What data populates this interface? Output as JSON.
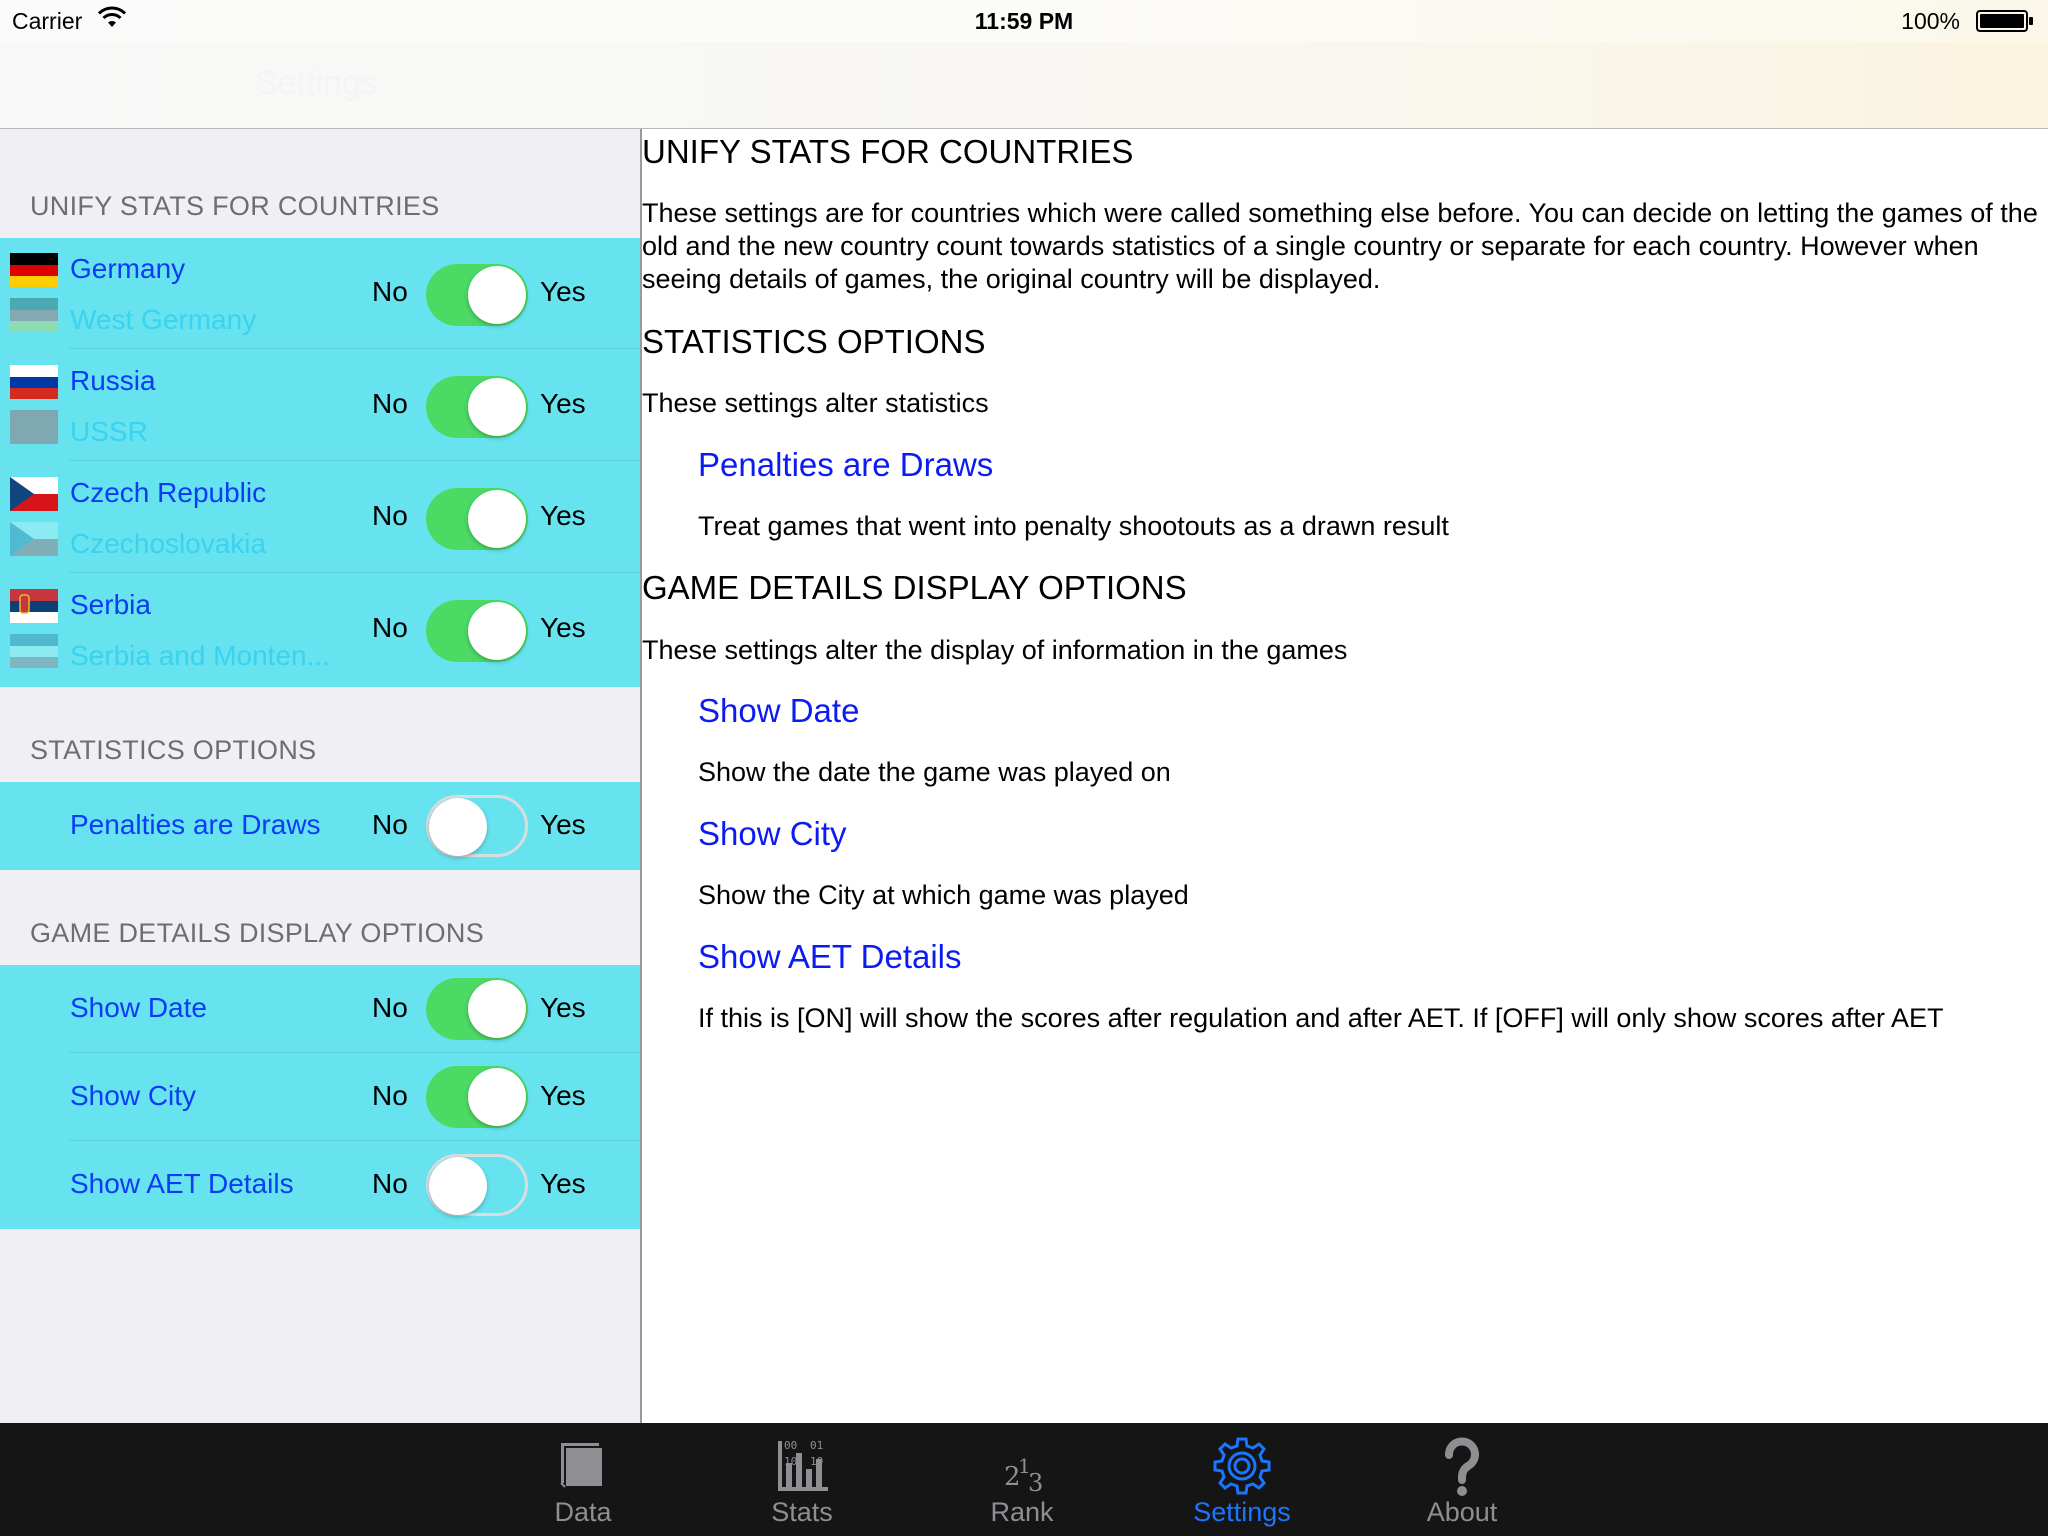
{
  "status_bar": {
    "carrier": "Carrier",
    "time": "11:59 PM",
    "battery": "100%"
  },
  "nav_bar": {
    "title": "Settings"
  },
  "left": {
    "unify": {
      "header": "UNIFY STATS FOR COUNTRIES",
      "rows": [
        {
          "country": "Germany",
          "old_country": "West Germany",
          "no": "No",
          "yes": "Yes",
          "on": true
        },
        {
          "country": "Russia",
          "old_country": "USSR",
          "no": "No",
          "yes": "Yes",
          "on": true
        },
        {
          "country": "Czech Republic",
          "old_country": "Czechoslovakia",
          "no": "No",
          "yes": "Yes",
          "on": true
        },
        {
          "country": "Serbia",
          "old_country": "Serbia and Monten...",
          "no": "No",
          "yes": "Yes",
          "on": true
        }
      ]
    },
    "statistics": {
      "header": "STATISTICS OPTIONS",
      "rows": [
        {
          "label": "Penalties are Draws",
          "no": "No",
          "yes": "Yes",
          "on": false
        }
      ]
    },
    "game_details": {
      "header": "GAME DETAILS DISPLAY OPTIONS",
      "rows": [
        {
          "label": "Show Date",
          "no": "No",
          "yes": "Yes",
          "on": true
        },
        {
          "label": "Show City",
          "no": "No",
          "yes": "Yes",
          "on": true
        },
        {
          "label": "Show AET Details",
          "no": "No",
          "yes": "Yes",
          "on": false
        }
      ]
    }
  },
  "right": {
    "unify_heading": "UNIFY STATS FOR COUNTRIES",
    "unify_text": "These settings are for countries which were called something else before. You can decide on letting the games of the old and the new country count towards statistics of a single country or separate for each country. However when seeing details of games, the original country will be displayed.",
    "statistics_heading": "STATISTICS OPTIONS",
    "statistics_text": "These settings alter statistics",
    "penalties_link": "Penalties are Draws",
    "penalties_desc": "Treat games that went into penalty shootouts as a drawn result",
    "game_heading": "GAME DETAILS DISPLAY OPTIONS",
    "game_text": "These settings alter the display of information in the games",
    "show_date_link": "Show Date",
    "show_date_desc": "Show the date the game was played on",
    "show_city_link": "Show City",
    "show_city_desc": "Show the City at which game was played",
    "show_aet_link": "Show AET Details",
    "show_aet_desc": "If this is [ON] will show the scores after regulation and after AET. If [OFF] will only show scores after AET"
  },
  "tab_bar": {
    "tabs": [
      {
        "label": "Data",
        "icon": "book-icon"
      },
      {
        "label": "Stats",
        "icon": "stats-icon"
      },
      {
        "label": "Rank",
        "icon": "rank-icon"
      },
      {
        "label": "Settings",
        "icon": "gear-icon",
        "active": true
      },
      {
        "label": "About",
        "icon": "question-mark-icon"
      }
    ],
    "active_color": "#1a75ff",
    "inactive_color": "#8e8e93"
  },
  "colors": {
    "group_background": "#66e3ef",
    "switch_on": "#4cd964",
    "link_blue": "#0b3cf2",
    "old_country_text": "#3bd2f0"
  }
}
